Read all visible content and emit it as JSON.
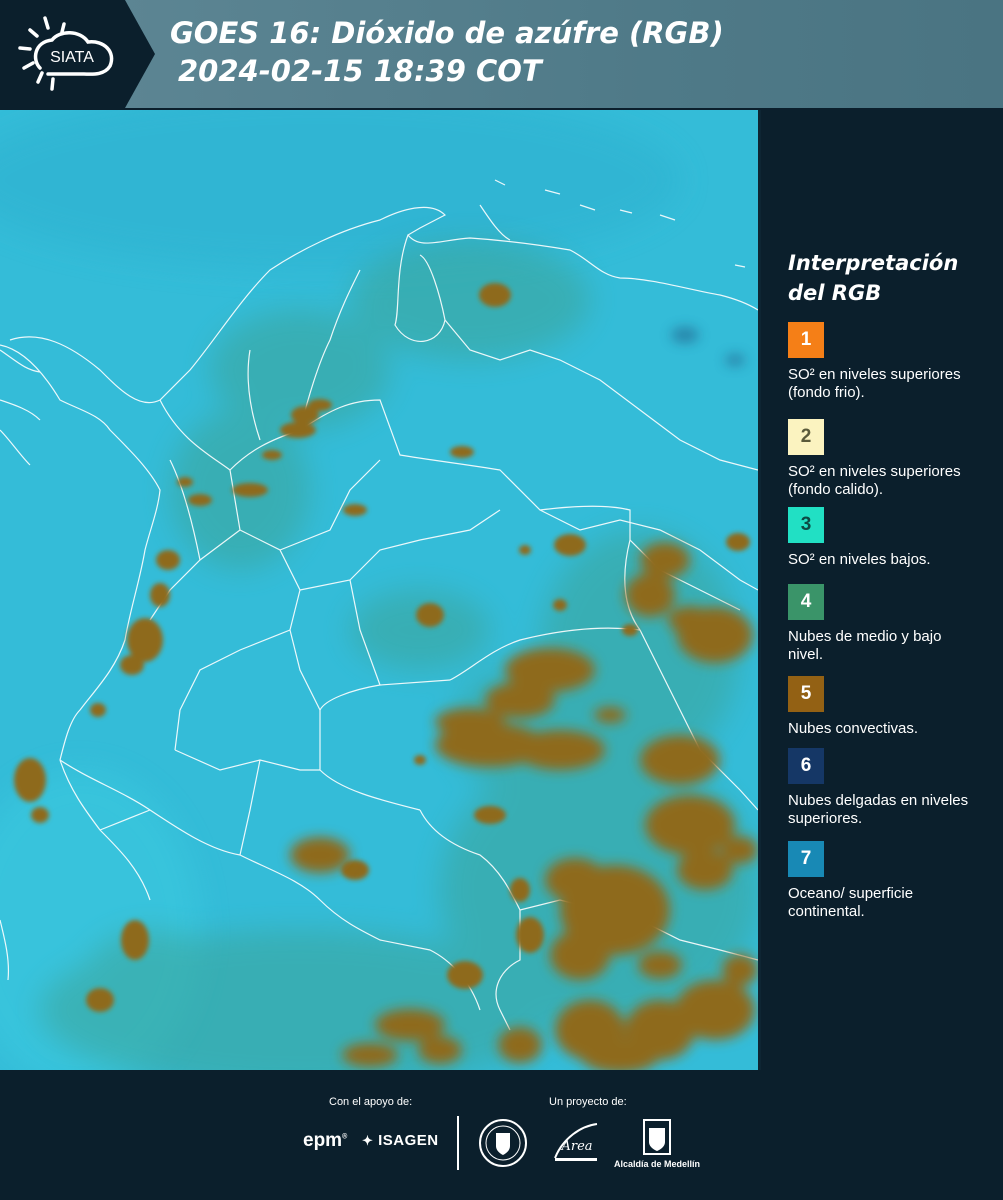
{
  "header": {
    "title_line1": "GOES 16: Dióxido de azúfre (RGB)",
    "title_line2": "2024-02-15 18:39 COT",
    "logo_text": "SIATA"
  },
  "legend": {
    "title_line1": "Interpretación",
    "title_line2": "del RGB",
    "items": [
      {
        "number": "1",
        "color": "#f57f17",
        "text_color": "#ffffff",
        "label": "SO² en niveles superiores (fondo frio)."
      },
      {
        "number": "2",
        "color": "#fbf3c0",
        "text_color": "#5a5a3a",
        "label": "SO² en niveles superiores (fondo calido)."
      },
      {
        "number": "3",
        "color": "#21e0c4",
        "text_color": "#0d4a44",
        "label": "SO² en niveles bajos."
      },
      {
        "number": "4",
        "color": "#3a9469",
        "text_color": "#ffffff",
        "label": "Nubes de medio y bajo nivel."
      },
      {
        "number": "5",
        "color": "#936114",
        "text_color": "#ffffff",
        "label": "Nubes convectivas."
      },
      {
        "number": "6",
        "color": "#153766",
        "text_color": "#ffffff",
        "label": "Nubes delgadas en niveles superiores."
      },
      {
        "number": "7",
        "color": "#1889b5",
        "text_color": "#ffffff",
        "label": "Oceano/ superficie continental."
      }
    ]
  },
  "footer": {
    "support_label": "Con el apoyo de:",
    "project_label": "Un proyecto de:",
    "sponsor1": "epm",
    "sponsor2": "ISAGEN",
    "partner_label": "Alcaldía de Medellín",
    "area_logo_text": "Área"
  },
  "colors": {
    "background": "#0b1f2c",
    "title_band": "#5c8593",
    "map_base": "#34bcd8",
    "convective": "#936114",
    "mid_low": "#3a9469",
    "border_lines": "#ffffff"
  }
}
